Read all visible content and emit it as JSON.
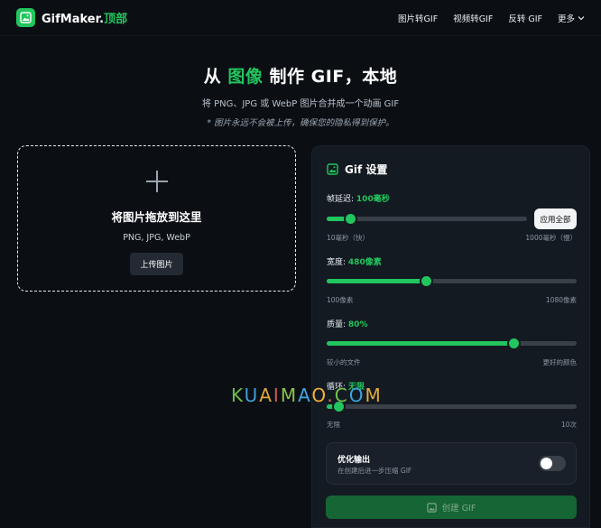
{
  "brand": {
    "name": "GifMaker.",
    "suffix": "顶部",
    "color": "#22c55e"
  },
  "nav": {
    "items": [
      "图片转GIF",
      "视频转GIF",
      "反转 GIF",
      "更多"
    ]
  },
  "hero": {
    "title_a": "从 ",
    "title_hl": "图像",
    "title_b": " 制作 GIF，本地",
    "subtitle": "将 PNG、JPG 或 WebP 图片合并成一个动画 GIF",
    "note": "* 图片永远不会被上传，确保您的隐私得到保护。"
  },
  "drop": {
    "title": "将图片拖放到这里",
    "formats": "PNG, JPG, WebP",
    "upload": "上传图片"
  },
  "panel": {
    "title": "Gif 设置",
    "apply_all": "应用全部",
    "delay": {
      "label": "帧延迟:",
      "value": "100毫秒",
      "min": "10毫秒（快）",
      "max": "1000毫秒（慢）",
      "level": 0.12
    },
    "width": {
      "label": "宽度:",
      "value": "480像素",
      "min": "100像素",
      "max": "1080像素",
      "level": 0.4
    },
    "quality": {
      "label": "质量:",
      "value": "80%",
      "min": "较小的文件",
      "max": "更好的颜色",
      "level": 0.75
    },
    "loop": {
      "label": "循环:",
      "value": "无限",
      "min": "无限",
      "max": "10次",
      "level": 0.05
    },
    "optimize": {
      "title": "优化输出",
      "desc": "在创建后进一步压缩 GIF",
      "on": false
    },
    "create": "创建 GIF"
  },
  "watermark": {
    "text": "KUAIMAO.COM"
  }
}
